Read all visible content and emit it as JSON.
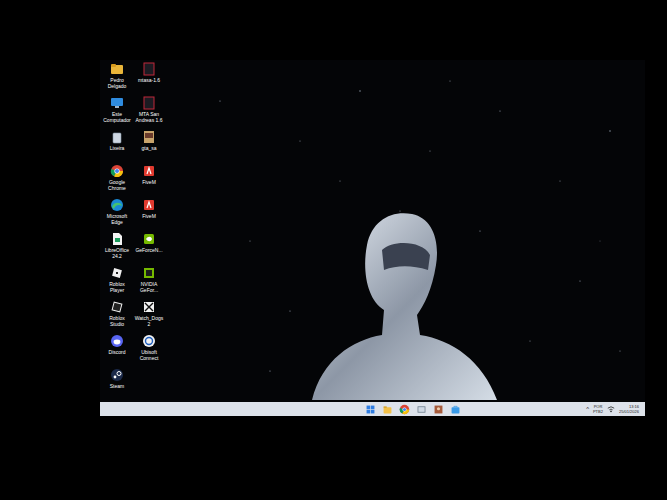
{
  "desktop": {
    "columns": [
      [
        {
          "label": "Pedro Delgado",
          "kind": "folder"
        },
        {
          "label": "Este Computador",
          "kind": "pc"
        },
        {
          "label": "Lixeira",
          "kind": "trash"
        },
        {
          "label": "Google Chrome",
          "kind": "chrome"
        },
        {
          "label": "Microsoft Edge",
          "kind": "edge"
        },
        {
          "label": "LibreOffice 24.2",
          "kind": "libreoffice"
        },
        {
          "label": "Roblox Player",
          "kind": "roblox"
        },
        {
          "label": "Roblox Studio",
          "kind": "robloxstudio"
        },
        {
          "label": "Discord",
          "kind": "discord"
        },
        {
          "label": "Steam",
          "kind": "steam"
        }
      ],
      [
        {
          "label": "mtasa-1.6",
          "kind": "mta"
        },
        {
          "label": "MTA San Andreas 1.6",
          "kind": "mta"
        },
        {
          "label": "gta_sa",
          "kind": "gta"
        },
        {
          "label": "FiveM",
          "kind": "fivem"
        },
        {
          "label": "FiveM",
          "kind": "fivem"
        },
        {
          "label": "GeForceN...",
          "kind": "geforce"
        },
        {
          "label": "NVIDIA GeFor...",
          "kind": "nvidia"
        },
        {
          "label": "Watch_Dogs 2",
          "kind": "watchdogs"
        },
        {
          "label": "Ubisoft Connect",
          "kind": "ubisoft"
        }
      ]
    ]
  },
  "taskbar": {
    "apps": [
      {
        "kind": "start"
      },
      {
        "kind": "explorer"
      },
      {
        "kind": "chrome"
      },
      {
        "kind": "files"
      },
      {
        "kind": "photo"
      },
      {
        "kind": "store"
      }
    ]
  },
  "tray": {
    "chevron": "^",
    "language": "POR",
    "layout": "PTB2",
    "time": "13:16",
    "date": "25/01/2026"
  }
}
